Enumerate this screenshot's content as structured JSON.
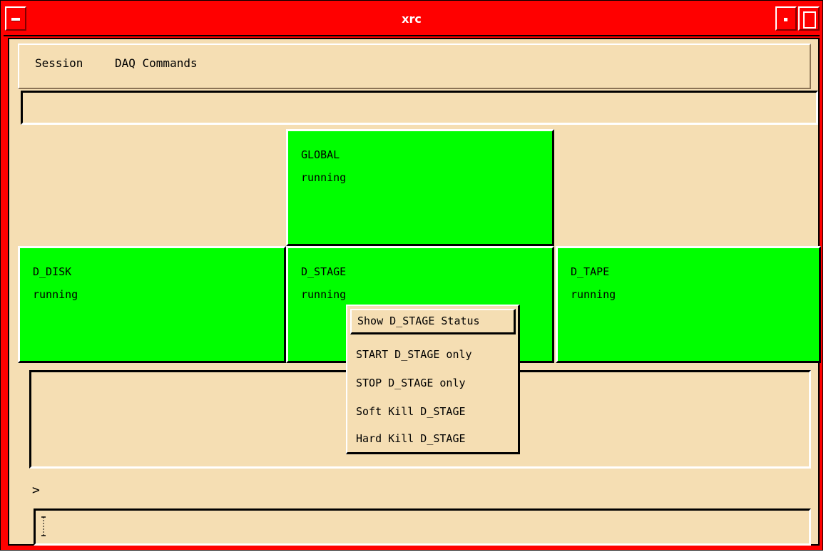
{
  "window": {
    "title": "xrc"
  },
  "menubar": {
    "items": [
      "Session",
      "DAQ Commands"
    ]
  },
  "status_line": "",
  "nodes": {
    "global": {
      "name": "GLOBAL",
      "state": "running"
    },
    "d_disk": {
      "name": "D_DISK",
      "state": "running"
    },
    "d_stage": {
      "name": "D_STAGE",
      "state": "running"
    },
    "d_tape": {
      "name": "D_TAPE",
      "state": "running"
    }
  },
  "context_menu": {
    "items": [
      "Show D_STAGE Status",
      "START D_STAGE only",
      "STOP D_STAGE only",
      "Soft Kill D_STAGE",
      "Hard Kill D_STAGE"
    ],
    "active_index": 0
  },
  "prompt": ">",
  "command_input": {
    "value": ""
  },
  "colors": {
    "titlebar": "#ff0000",
    "background": "#f5deb3",
    "node_running": "#00ff00"
  }
}
